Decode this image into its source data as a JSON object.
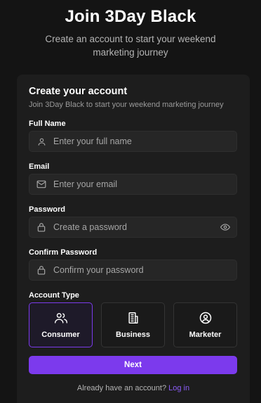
{
  "header": {
    "title": "Join 3Day Black",
    "subtitle": "Create an account to start your weekend marketing journey"
  },
  "card": {
    "title": "Create your account",
    "subtitle": "Join 3Day Black to start your weekend marketing journey"
  },
  "fields": {
    "full_name": {
      "label": "Full Name",
      "placeholder": "Enter your full name",
      "value": "",
      "icon": "user-icon"
    },
    "email": {
      "label": "Email",
      "placeholder": "Enter your email",
      "value": "",
      "icon": "mail-icon"
    },
    "password": {
      "label": "Password",
      "placeholder": "Create a password",
      "value": "",
      "icon": "lock-icon",
      "toggle_icon": "eye-icon"
    },
    "confirm_password": {
      "label": "Confirm Password",
      "placeholder": "Confirm your password",
      "value": "",
      "icon": "lock-icon"
    }
  },
  "account_type": {
    "label": "Account Type",
    "selected": "Consumer",
    "options": [
      {
        "label": "Consumer",
        "icon": "users-icon"
      },
      {
        "label": "Business",
        "icon": "building-icon"
      },
      {
        "label": "Marketer",
        "icon": "user-circle-icon"
      }
    ]
  },
  "actions": {
    "next_label": "Next",
    "login_prompt": "Already have an account?",
    "login_link": "Log in"
  },
  "colors": {
    "background": "#141414",
    "card": "#1d1d1d",
    "accent": "#7c3aed",
    "link": "#8b5cf6"
  }
}
